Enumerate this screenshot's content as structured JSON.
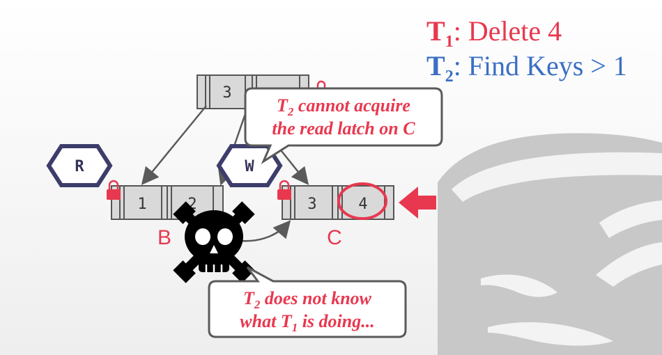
{
  "legend": {
    "t1": {
      "letter": "T",
      "sub": "1",
      "text": ": Delete 4",
      "color": "#e8384f"
    },
    "t2": {
      "letter": "T",
      "sub": "2",
      "text": ": Find Keys > 1",
      "color": "#3a6fc4"
    }
  },
  "tree": {
    "root": {
      "keys": [
        "3",
        ""
      ]
    },
    "node_b": {
      "label": "B",
      "keys": [
        "1",
        "2"
      ]
    },
    "node_c": {
      "label": "C",
      "keys": [
        "3",
        "4"
      ]
    }
  },
  "latches": {
    "r": "R",
    "w": "W"
  },
  "callouts": {
    "top": {
      "line1_pre": "T",
      "line1_sub": "2",
      "line1_post": " cannot acquire",
      "line2": "the read latch on C"
    },
    "bottom": {
      "line1_pre": "T",
      "line1_sub": "2",
      "line1_post": " does not know",
      "line2_pre": "what T",
      "line2_sub": "1",
      "line2_post": " is doing..."
    }
  },
  "colors": {
    "accent_red": "#e8384f",
    "accent_blue": "#3a6fc4",
    "node_fill": "#d9d9d9",
    "latch_border": "#3d3d6b",
    "database_gray": "#c6c6c6"
  },
  "icons": [
    "skull-crossbones-icon",
    "padlock-icon",
    "database-icon",
    "arrow-left-icon"
  ]
}
